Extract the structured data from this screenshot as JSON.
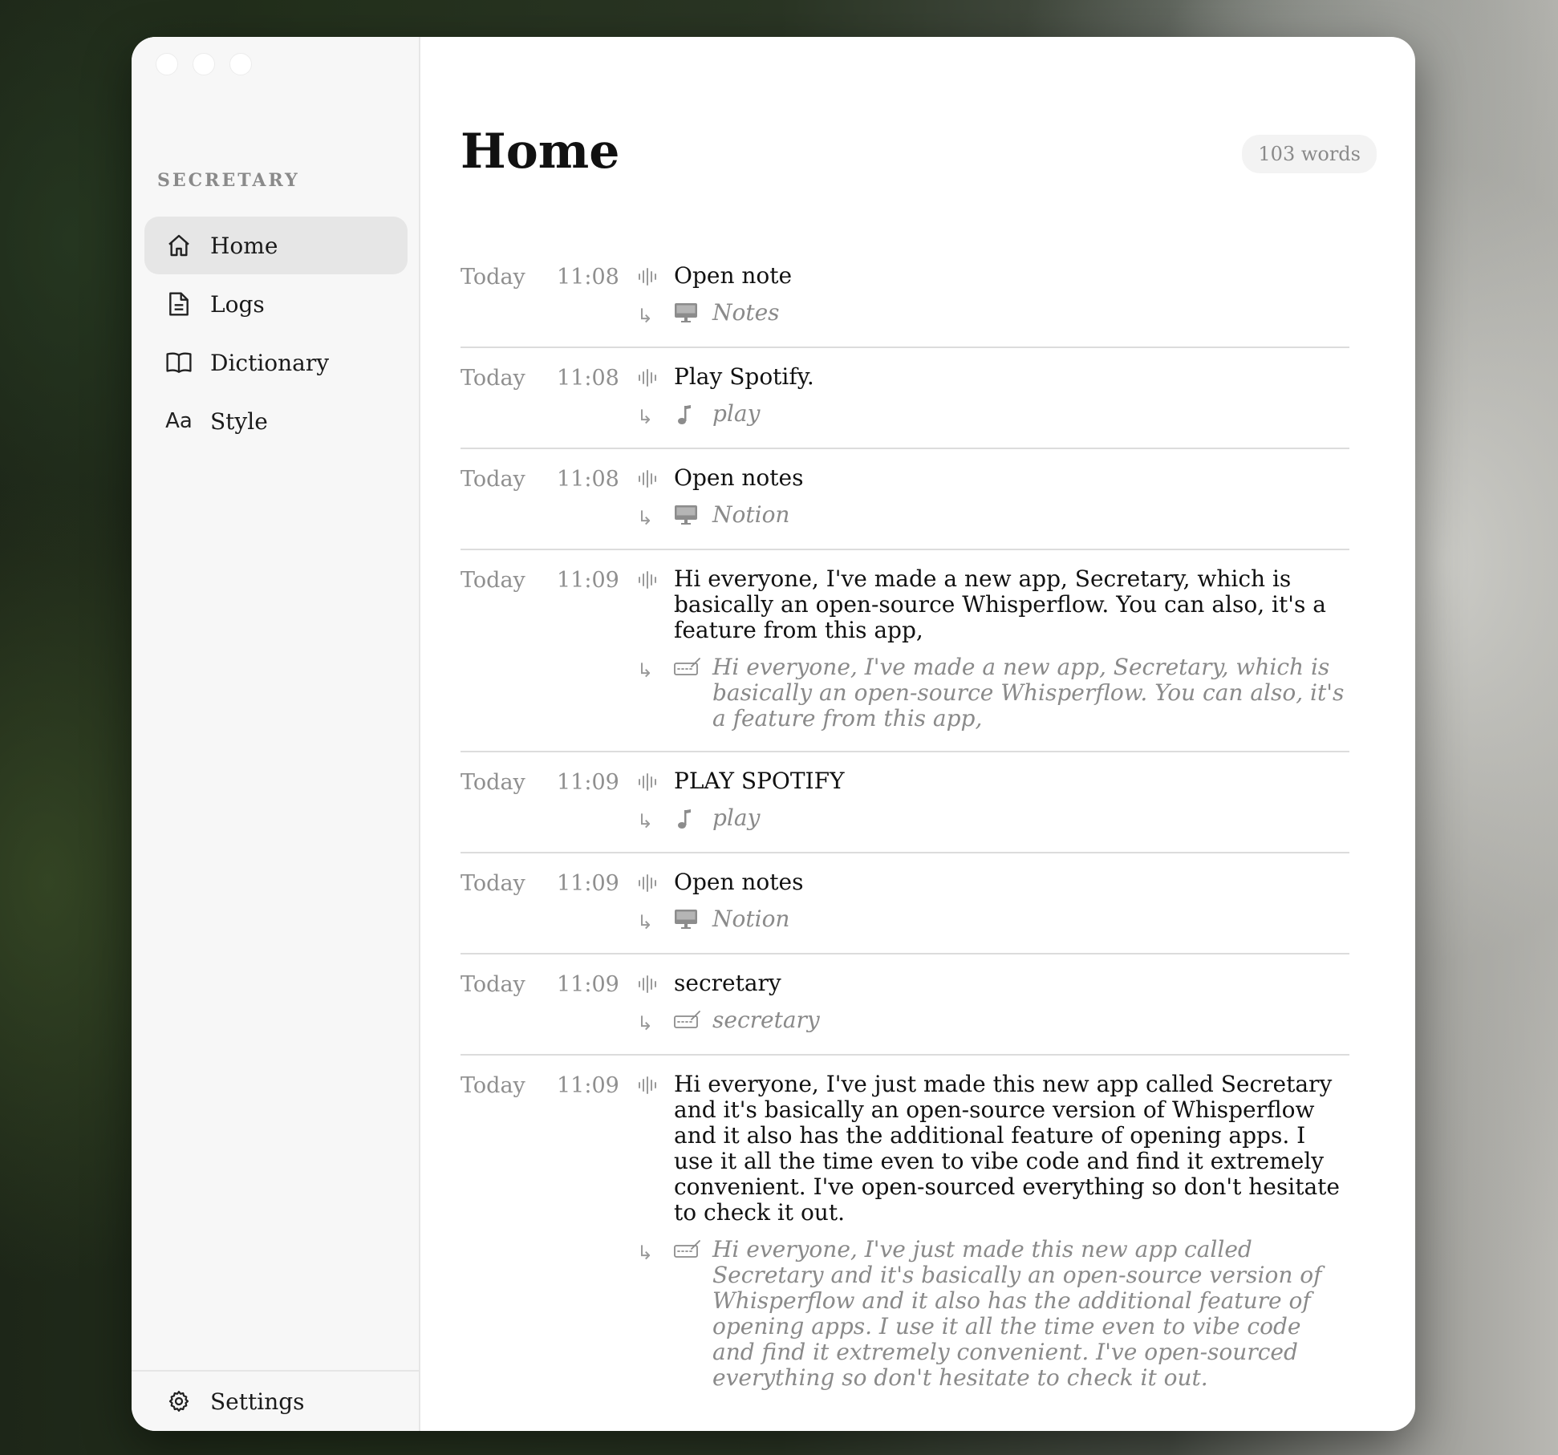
{
  "app": {
    "brand": "SECRETARY",
    "page_title": "Home",
    "word_count": "103 words"
  },
  "sidebar": {
    "items": [
      {
        "label": "Home",
        "icon": "home-icon",
        "active": true
      },
      {
        "label": "Logs",
        "icon": "document-icon",
        "active": false
      },
      {
        "label": "Dictionary",
        "icon": "book-icon",
        "active": false
      },
      {
        "label": "Style",
        "icon": "text-style-icon",
        "active": false
      }
    ],
    "style_icon_text": "Aa",
    "settings_label": "Settings"
  },
  "entries": [
    {
      "date": "Today",
      "time": "11:08",
      "spoken": "Open note",
      "kind": "app",
      "result": "Notes"
    },
    {
      "date": "Today",
      "time": "11:08",
      "spoken": "Play Spotify.",
      "kind": "music",
      "result": "play"
    },
    {
      "date": "Today",
      "time": "11:08",
      "spoken": "Open notes",
      "kind": "app",
      "result": "Notion"
    },
    {
      "date": "Today",
      "time": "11:09",
      "spoken": "Hi everyone, I've made a new app, Secretary, which is basically an open-source Whisperflow. You can also, it's a feature from this app,",
      "kind": "dictation",
      "result": "Hi everyone, I've made a new app, Secretary, which is basically an open-source Whisperflow. You can also, it's a feature from this app,"
    },
    {
      "date": "Today",
      "time": "11:09",
      "spoken": "PLAY SPOTIFY",
      "kind": "music",
      "result": "play"
    },
    {
      "date": "Today",
      "time": "11:09",
      "spoken": "Open notes",
      "kind": "app",
      "result": "Notion"
    },
    {
      "date": "Today",
      "time": "11:09",
      "spoken": "secretary",
      "kind": "dictation",
      "result": "secretary"
    },
    {
      "date": "Today",
      "time": "11:09",
      "spoken": "Hi everyone, I've just made this new app called Secretary and it's basically an open-source version of Whisperflow and it also has the additional feature of opening apps. I use it all the time even to vibe code and find it extremely convenient. I've open-sourced everything so don't hesitate to check it out.",
      "kind": "dictation",
      "result": "Hi everyone, I've just made this new app called Secretary and it's basically an open-source version of Whisperflow and it also has the additional feature of opening apps. I use it all the time even to vibe code and find it extremely convenient. I've open-sourced everything so don't hesitate to check it out."
    }
  ],
  "glyphs": {
    "arrow": "↳"
  },
  "colors": {
    "active_nav_bg": "#e6e6e6",
    "muted_text": "#8a8a8a",
    "divider": "#dcdcdc"
  }
}
